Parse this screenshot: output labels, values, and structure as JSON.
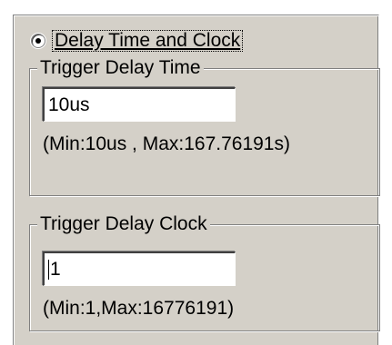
{
  "mode": {
    "label": "Delay Time and Clock",
    "selected": true
  },
  "trigger_delay_time": {
    "title": "Trigger Delay Time",
    "value": "10us",
    "range": "(Min:10us , Max:167.76191s)"
  },
  "trigger_delay_clock": {
    "title": "Trigger Delay Clock",
    "value": "1",
    "range": "(Min:1,Max:16776191)"
  }
}
